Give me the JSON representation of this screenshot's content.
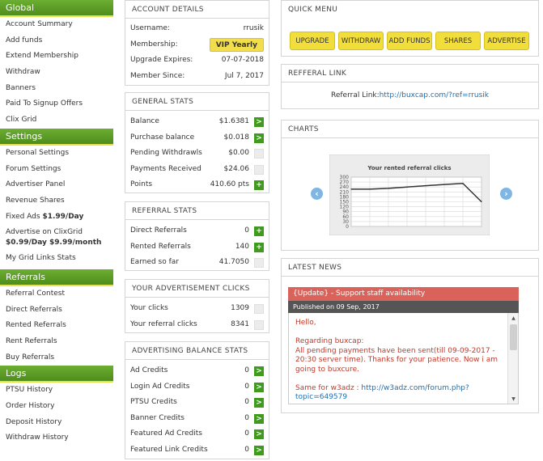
{
  "sidebar": {
    "sections": [
      {
        "title": "Global",
        "items": [
          "Account Summary",
          "Add funds",
          "Extend Membership",
          "Withdraw",
          "Banners",
          "Paid To Signup Offers",
          "Clix Grid"
        ]
      },
      {
        "title": "Settings",
        "items": [
          "Personal Settings",
          "Forum Settings",
          "Advertiser Panel",
          "Revenue Shares"
        ]
      },
      {
        "title": "Referrals",
        "items": [
          "Referral Contest",
          "Direct Referrals",
          "Rented Referrals",
          "Rent Referrals",
          "Buy Referrals"
        ]
      },
      {
        "title": "Logs",
        "items": [
          "PTSU History",
          "Order History",
          "Deposit History",
          "Withdraw History"
        ]
      }
    ],
    "fixed_ads": {
      "label": "Fixed Ads ",
      "price": "$1.99/Day"
    },
    "advertise_clixgrid": {
      "label": "Advertise on ClixGrid",
      "price": "$0.99/Day $9.99/month"
    },
    "grid_links_stats": "My Grid Links Stats"
  },
  "account_details": {
    "title": "ACCOUNT DETAILS",
    "username_label": "Username:",
    "username": "rrusik",
    "membership_label": "Membership:",
    "membership": "VIP Yearly",
    "expires_label": "Upgrade Expires:",
    "expires": "07-07-2018",
    "since_label": "Member Since:",
    "since": "Jul 7, 2017"
  },
  "general_stats": {
    "title": "GENERAL STATS",
    "rows": [
      {
        "label": "Balance",
        "value": "$1.6381",
        "action": "go"
      },
      {
        "label": "Purchase balance",
        "value": "$0.018",
        "action": "go"
      },
      {
        "label": "Pending Withdrawls",
        "value": "$0.00",
        "action": "none"
      },
      {
        "label": "Payments Received",
        "value": "$24.06",
        "action": "none"
      },
      {
        "label": "Points",
        "value": "410.60 pts",
        "action": "add"
      }
    ]
  },
  "referral_stats": {
    "title": "REFERRAL STATS",
    "rows": [
      {
        "label": "Direct Referrals",
        "value": "0",
        "action": "add"
      },
      {
        "label": "Rented Referrals",
        "value": "140",
        "action": "add"
      },
      {
        "label": "Earned so far",
        "value": "41.7050",
        "action": "none"
      }
    ]
  },
  "ad_clicks": {
    "title": "YOUR ADVERTISEMENT CLICKS",
    "rows": [
      {
        "label": "Your clicks",
        "value": "1309"
      },
      {
        "label": "Your referral clicks",
        "value": "8341"
      }
    ]
  },
  "ad_balance": {
    "title": "ADVERTISING BALANCE STATS",
    "rows": [
      {
        "label": "Ad Credits",
        "value": "0"
      },
      {
        "label": "Login Ad Credits",
        "value": "0"
      },
      {
        "label": "PTSU Credits",
        "value": "0"
      },
      {
        "label": "Banner Credits",
        "value": "0"
      },
      {
        "label": "Featured Ad Credits",
        "value": "0"
      },
      {
        "label": "Featured Link Credits",
        "value": "0"
      }
    ]
  },
  "quick_menu": {
    "title": "QUICK MENU",
    "buttons": [
      "UPGRADE",
      "WITHDRAW",
      "ADD FUNDS",
      "SHARES",
      "ADVERTISE"
    ]
  },
  "referral_link": {
    "title": "REFFERAL LINK",
    "label": "Referral Link:",
    "url": "http://buxcap.com/?ref=rrusik"
  },
  "charts": {
    "title": "CHARTS"
  },
  "chart_data": {
    "type": "line",
    "title": "Your rented referral clicks",
    "ylim": [
      0,
      300
    ],
    "yticks": [
      "300",
      "270",
      "240",
      "210",
      "180",
      "150",
      "120",
      "90",
      "60",
      "30",
      "0"
    ],
    "grid": true,
    "series": [
      {
        "values": [
          227,
          227,
          232,
          240,
          248,
          255,
          262,
          150
        ]
      }
    ],
    "colors": {
      "line": "#333333",
      "grid": "#d8d8d8",
      "plot_bg": "#ffffff",
      "panel_bg": "#ececec"
    }
  },
  "news": {
    "title": "LATEST NEWS",
    "headline": "{Update} - Support staff availability",
    "date": "Published on 09 Sep, 2017",
    "greeting": "Hello,",
    "regarding": "Regarding buxcap:",
    "body": "All pending payments have been sent(till 09-09-2017 - 20:30 server time). Thanks for your patience. Now i am going to buxcure.",
    "same_for_label": "Same for w3adz : ",
    "same_for_link": "http://w3adz.com/forum.php?topic=649579"
  },
  "colors": {
    "accent_green": "#4e8c1c",
    "button_yellow": "#f2de3b",
    "news_red": "#d9635a",
    "link_blue": "#1c6fb5"
  }
}
